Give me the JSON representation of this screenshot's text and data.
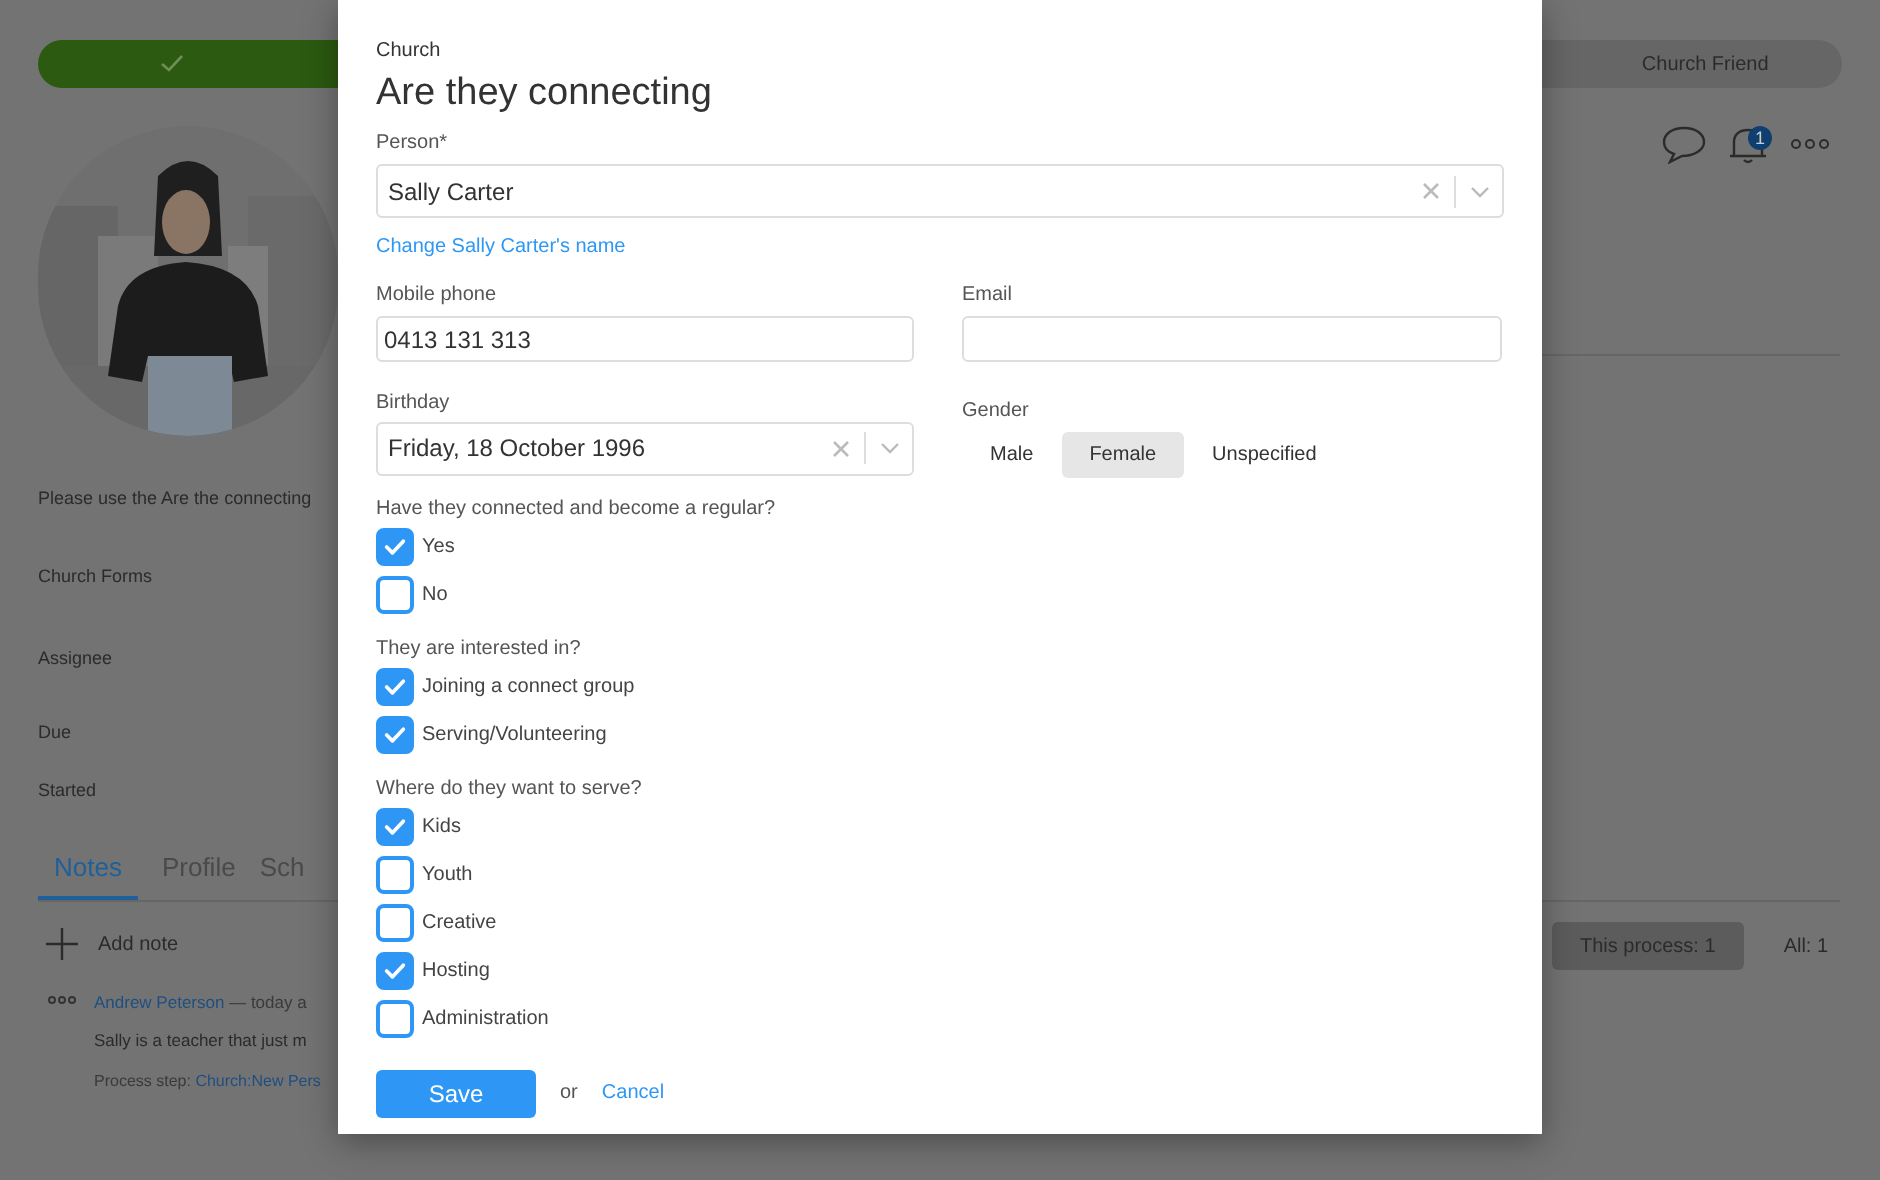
{
  "steps": [
    {
      "done": true
    },
    {
      "label": "Church Friend",
      "done": false
    }
  ],
  "notification_count": "1",
  "details": [
    "Please use the Are the connecting",
    "Church Forms",
    "Assignee",
    "Due",
    "Started"
  ],
  "tabs": [
    {
      "label": "Notes",
      "selected": true
    },
    {
      "label": "Profile",
      "selected": false
    },
    {
      "label": "Sch",
      "selected": false
    }
  ],
  "add_note": "Add note",
  "note": {
    "author": "Andrew Peterson",
    "meta": "— today a",
    "text": "Sally is a teacher that just m",
    "step_label": "Process step:",
    "step_link": "Church:New Pers"
  },
  "filters": [
    {
      "label": "This process: 1",
      "selected": true
    },
    {
      "label": "All: 1",
      "selected": false
    }
  ],
  "modal": {
    "subtitle": "Church",
    "title": "Are they connecting",
    "person": {
      "label": "Person*",
      "value": "Sally Carter"
    },
    "change_link": "Change Sally Carter's name",
    "mobile": {
      "label": "Mobile phone",
      "value": "0413 131 313"
    },
    "email": {
      "label": "Email"
    },
    "birthday": {
      "label": "Birthday",
      "value": "Friday, 18 October 1996"
    },
    "gender": {
      "label": "Gender",
      "options": [
        {
          "label": "Male",
          "selected": false
        },
        {
          "label": "Female",
          "selected": true
        },
        {
          "label": "Unspecified",
          "selected": false
        }
      ]
    },
    "questions": [
      {
        "label": "Have they connected and become a regular?",
        "options": [
          {
            "label": "Yes",
            "checked": true
          },
          {
            "label": "No",
            "checked": false
          }
        ]
      },
      {
        "label": "They are interested in?",
        "options": [
          {
            "label": "Joining a connect group",
            "checked": true
          },
          {
            "label": "Serving/Volunteering",
            "checked": true
          }
        ]
      },
      {
        "label": "Where do they want to serve?",
        "options": [
          {
            "label": "Kids",
            "checked": true
          },
          {
            "label": "Youth",
            "checked": false
          },
          {
            "label": "Creative",
            "checked": false
          },
          {
            "label": "Hosting",
            "checked": true
          },
          {
            "label": "Administration",
            "checked": false
          }
        ]
      }
    ],
    "save": "Save",
    "or": "or",
    "cancel": "Cancel"
  }
}
